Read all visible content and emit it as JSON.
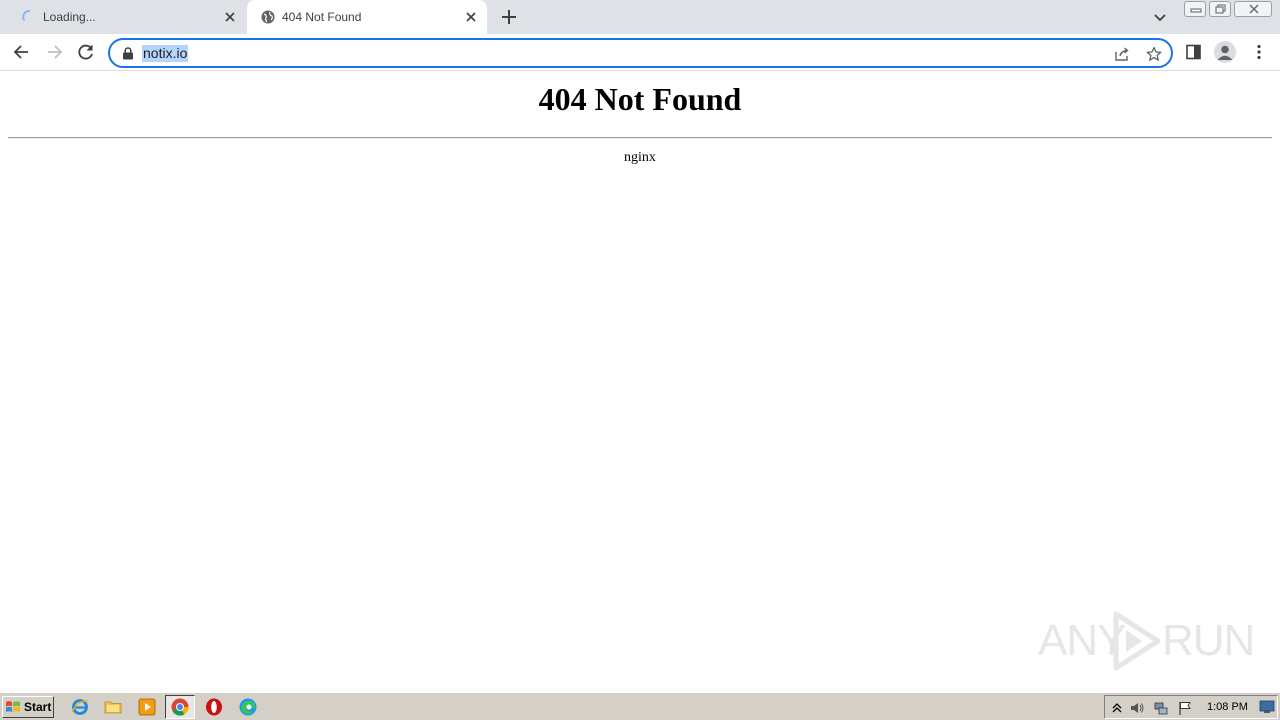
{
  "browser": {
    "tabs": [
      {
        "title": "Loading...",
        "state": "loading"
      },
      {
        "title": "404 Not Found",
        "state": "active"
      }
    ],
    "address_bar": {
      "url": "notix.io"
    }
  },
  "page": {
    "heading": "404 Not Found",
    "server": "nginx"
  },
  "watermark": {
    "text_left": "ANY",
    "text_right": "RUN"
  },
  "taskbar": {
    "start_label": "Start",
    "clock": "1:08 PM"
  },
  "colors": {
    "tabstrip_bg": "#dee1e6",
    "omnibox_focus": "#1a73e8",
    "url_selection": "#b4d4fb",
    "taskbar_bg": "#d4d0c8"
  }
}
